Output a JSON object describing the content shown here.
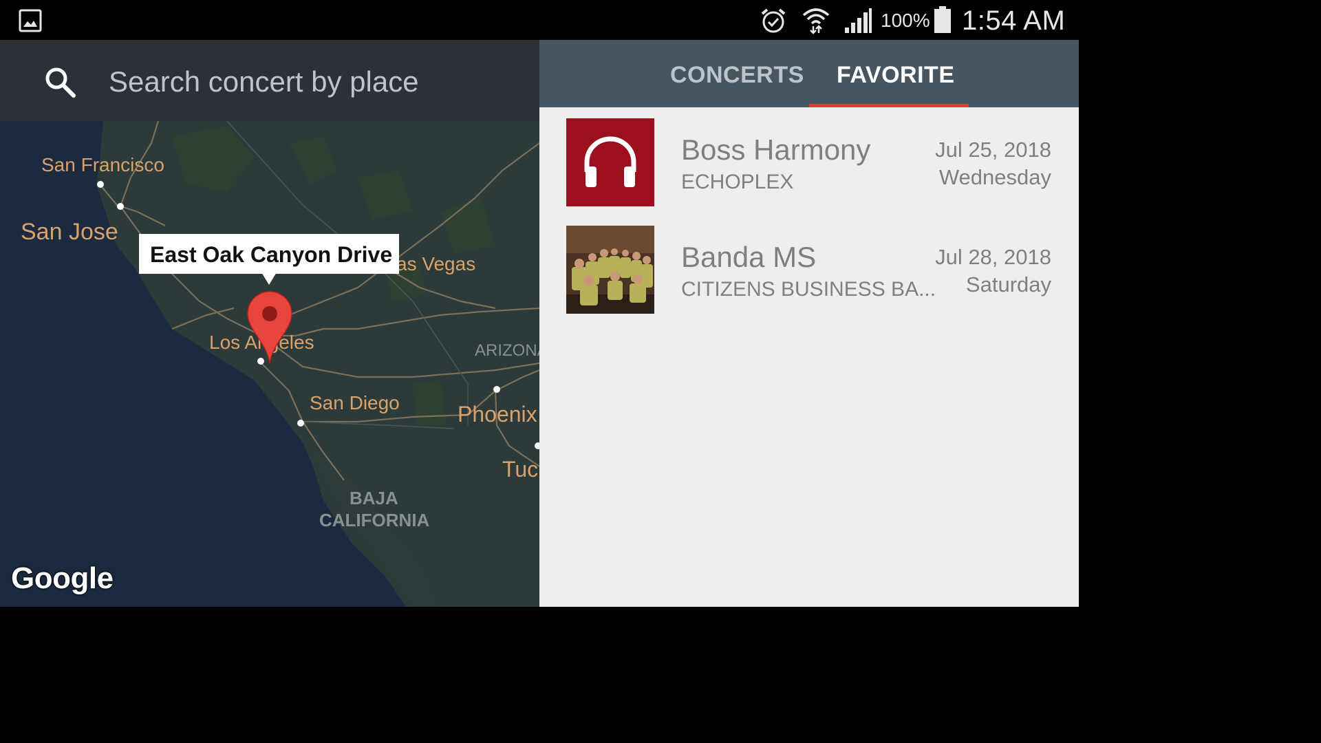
{
  "status_bar": {
    "battery_percent": "100%",
    "time": "1:54 AM"
  },
  "map": {
    "search_placeholder": "Search concert by place",
    "callout": "East Oak Canyon Drive",
    "attribution": "Google",
    "labels": {
      "san_francisco": "San Francisco",
      "san_jose": "San Jose",
      "las_vegas": "as Vegas",
      "los_angeles": "Los Angeles",
      "san_diego": "San Diego",
      "phoenix": "Phoenix",
      "tucson": "Tuc",
      "arizona": "ARIZONA",
      "baja_line1": "BAJA",
      "baja_line2": "CALIFORNIA"
    }
  },
  "tabs": {
    "concerts": "CONCERTS",
    "favorite": "FAVORITE",
    "active": "favorite"
  },
  "favorites": [
    {
      "title": "Boss Harmony",
      "venue": "ECHOPLEX",
      "date": "Jul 25, 2018",
      "weekday": "Wednesday",
      "thumb_icon": "headphones-icon"
    },
    {
      "title": "Banda MS",
      "venue": "CITIZENS BUSINESS BA...",
      "date": "Jul 28, 2018",
      "weekday": "Saturday",
      "thumb_icon": "band-photo"
    }
  ],
  "colors": {
    "tab_bar": "#46555f",
    "tab_indicator": "#e53935",
    "pin": "#e8453c",
    "map_water": "#1c2a3f",
    "map_land": "#2c3a3a",
    "thumb_red": "#9b0f1f"
  }
}
